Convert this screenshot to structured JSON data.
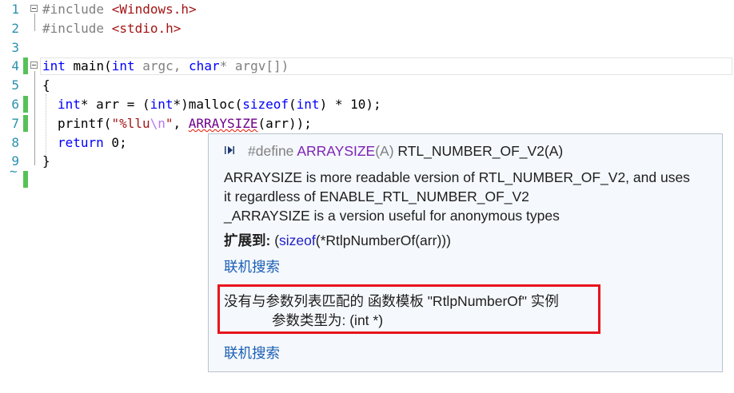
{
  "editor": {
    "line_numbers": [
      "1",
      "2",
      "3",
      "4",
      "5",
      "6",
      "7",
      "8",
      "9"
    ],
    "eof_marker": "~",
    "l1": {
      "hash_include": "#include",
      "header": "<Windows.h>"
    },
    "l2": {
      "hash_include": "#include",
      "header": "<stdio.h>"
    },
    "l4": {
      "int": "int",
      "main": " main(",
      "int2": "int",
      "argc": " argc, ",
      "char": "char",
      "argv": "* argv[])"
    },
    "l5": {
      "brace": "{"
    },
    "l6": {
      "int": "int",
      "a": "* arr = (",
      "int2": "int",
      "b": "*)malloc(",
      "sizeof": "sizeof",
      "c": "(",
      "int3": "int",
      "d": ") * 10);"
    },
    "l7": {
      "printf": "printf(",
      "str1": "\"%llu",
      "esc": "\\n",
      "str2": "\"",
      "comma": ", ",
      "macro": "ARRAYSIZE",
      "rest": "(arr));"
    },
    "l8": {
      "ret": "return",
      "rest": " 0;"
    },
    "l9": {
      "brace": "}"
    }
  },
  "tooltip": {
    "define_kw": "#define",
    "macro_name": "ARRAYSIZE",
    "macro_param": "(A)",
    "macro_value": " RTL_NUMBER_OF_V2(A)",
    "desc_line1": "ARRAYSIZE is more readable version of RTL_NUMBER_OF_V2, and uses",
    "desc_line2": "it regardless of ENABLE_RTL_NUMBER_OF_V2",
    "desc_line3": "_ARRAYSIZE is a version useful for anonymous types",
    "expands_label": "扩展到:",
    "expand_open": " (",
    "expand_sizeof": "sizeof",
    "expand_rest": "(*RtlpNumberOf(arr)))",
    "search_link1": "联机搜索",
    "error_line1": "没有与参数列表匹配的 函数模板 \"RtlpNumberOf\" 实例",
    "error_line2": "参数类型为:  (int *)",
    "search_link2": "联机搜索"
  },
  "colors": {
    "keyword": "#0000ff",
    "string": "#a31515",
    "macro": "#6f008a",
    "line_number": "#2b91af",
    "change_marker": "#57c157",
    "highlight_box": "#e8141c"
  },
  "icons": [
    "fold-collapse-icon",
    "signature-help-icon"
  ]
}
